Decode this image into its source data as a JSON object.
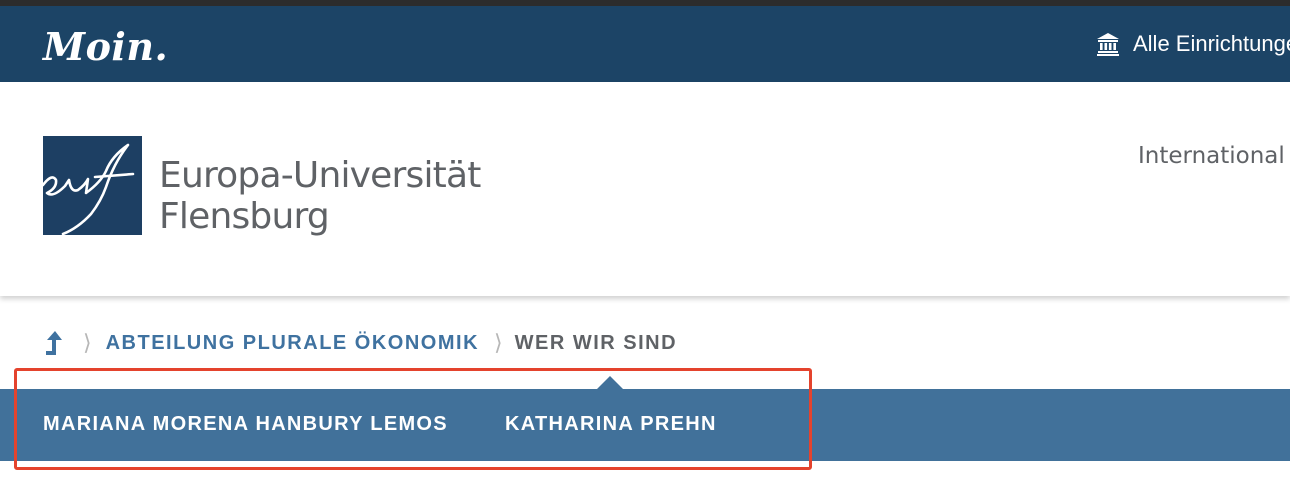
{
  "topbar": {
    "brand": "Moin.",
    "institutions_link": "Alle Einrichtungen",
    "institutions_icon": "institution-building-icon",
    "background": "#1c4466"
  },
  "header": {
    "logo": {
      "mark_text": "euf",
      "line1": "Europa-Universität",
      "line2": "Flensburg",
      "mark_color": "#1d3f63"
    },
    "international_link": "International"
  },
  "breadcrumb": {
    "up_icon": "arrow-up-icon",
    "separator": "⟩",
    "items": [
      {
        "label": "ABTEILUNG PLURALE ÖKONOMIK",
        "link": true
      },
      {
        "label": "WER WIR SIND",
        "current": true
      }
    ]
  },
  "subnav": {
    "background": "#41719a",
    "items": [
      {
        "label": "MARIANA MORENA HANBURY LEMOS"
      },
      {
        "label": "KATHARINA PREHN"
      }
    ]
  },
  "highlight_color": "#e4432d"
}
